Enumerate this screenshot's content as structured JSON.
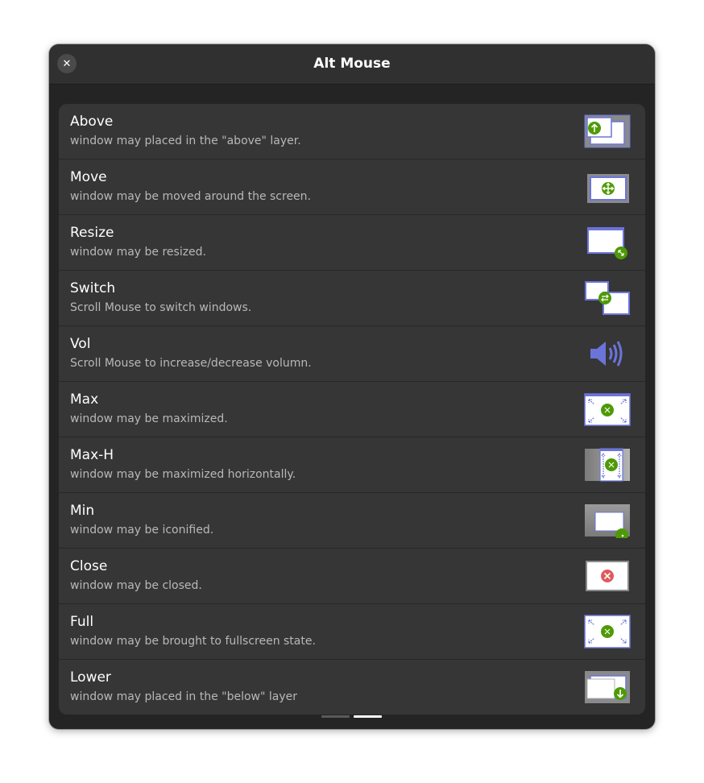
{
  "window": {
    "title": "Alt Mouse",
    "close_glyph": "✕"
  },
  "items": [
    {
      "title": "Above",
      "description": "window may placed in the \"above\" layer.",
      "icon": "above-layer-icon"
    },
    {
      "title": "Move",
      "description": "window may be moved around the screen.",
      "icon": "move-icon"
    },
    {
      "title": "Resize",
      "description": "window may be resized.",
      "icon": "resize-icon"
    },
    {
      "title": "Switch",
      "description": "Scroll Mouse to switch windows.",
      "icon": "switch-icon"
    },
    {
      "title": "Vol",
      "description": "Scroll Mouse to increase/decrease volumn.",
      "icon": "volume-icon"
    },
    {
      "title": "Max",
      "description": "window may be maximized.",
      "icon": "maximize-icon"
    },
    {
      "title": "Max-H",
      "description": "window may be maximized horizontally.",
      "icon": "maximize-horizontal-icon"
    },
    {
      "title": "Min",
      "description": "window may be iconified.",
      "icon": "minimize-icon"
    },
    {
      "title": "Close",
      "description": "window may be closed.",
      "icon": "close-window-icon"
    },
    {
      "title": "Full",
      "description": "window may be brought to fullscreen state.",
      "icon": "fullscreen-icon"
    },
    {
      "title": "Lower",
      "description": "window may placed in the \"below\" layer",
      "icon": "below-layer-icon"
    }
  ],
  "pager": {
    "pages": 2,
    "current": 2
  },
  "colors": {
    "accent_blue": "#6b74d9",
    "accent_green": "#4e9a06",
    "close_red": "#e05a5a"
  }
}
